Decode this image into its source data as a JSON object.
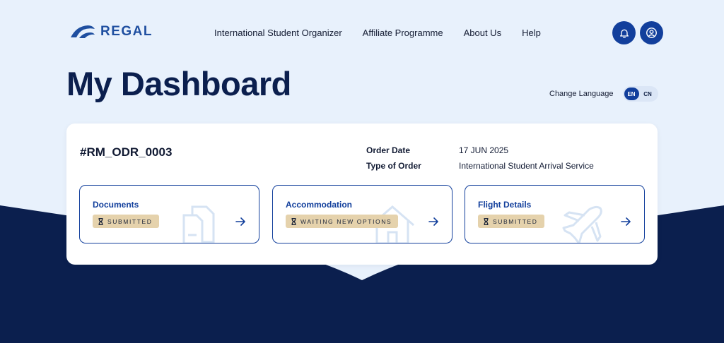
{
  "brand": {
    "name": "REGAL"
  },
  "nav": {
    "items": [
      {
        "label": "International Student Organizer"
      },
      {
        "label": "Affiliate Programme"
      },
      {
        "label": "About Us"
      },
      {
        "label": "Help"
      }
    ]
  },
  "header": {
    "notifications_icon": "bell-icon",
    "account_icon": "user-circle-icon"
  },
  "page": {
    "title": "My Dashboard"
  },
  "language": {
    "label": "Change Language",
    "options": [
      "EN",
      "CN"
    ],
    "selected": "EN"
  },
  "order": {
    "id": "#RM_ODR_0003",
    "order_date_label": "Order Date",
    "order_date_value": "17 JUN 2025",
    "order_type_label": "Type of Order",
    "order_type_value": "International Student Arrival Service",
    "sections": [
      {
        "title": "Documents",
        "status": "SUBMITTED",
        "icon": "document-icon"
      },
      {
        "title": "Accommodation",
        "status": "WAITING NEW OPTIONS",
        "icon": "house-icon"
      },
      {
        "title": "Flight Details",
        "status": "SUBMITTED",
        "icon": "airplane-icon"
      }
    ]
  },
  "colors": {
    "primary": "#123f9c",
    "navy_band": "#0b1f4e",
    "page_background": "#e8f1fc",
    "badge": "#e5d2ac"
  }
}
